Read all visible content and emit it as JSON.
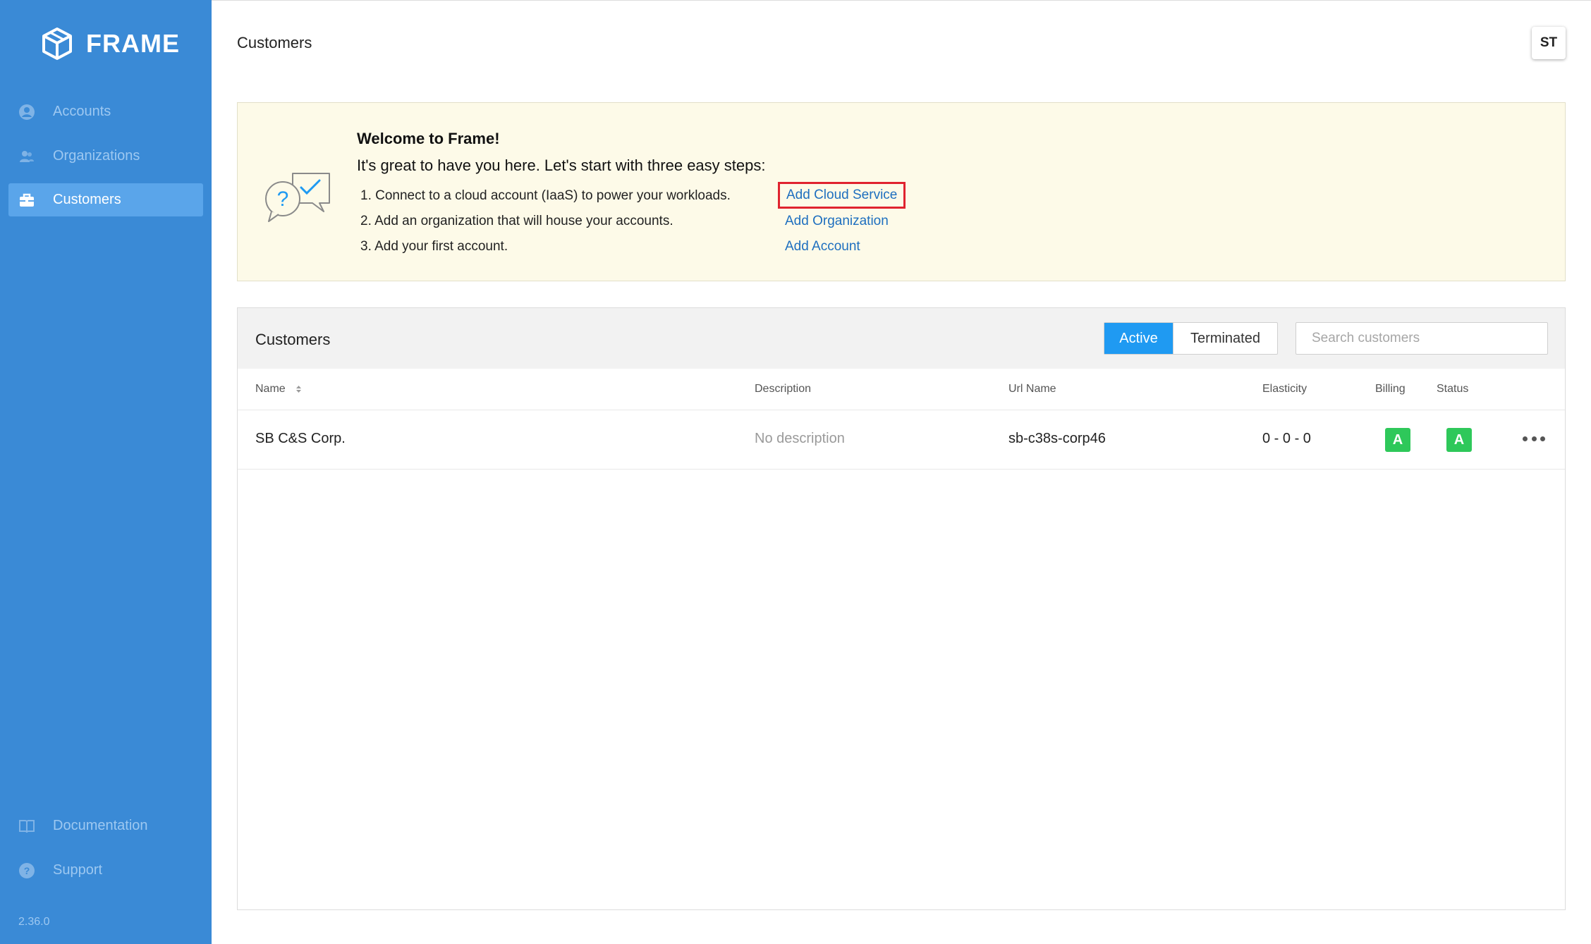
{
  "app": {
    "brand": "FRAME",
    "version": "2.36.0"
  },
  "sidebar": {
    "items": [
      {
        "label": "Accounts",
        "icon": "user-circle-icon",
        "active": false
      },
      {
        "label": "Organizations",
        "icon": "users-icon",
        "active": false
      },
      {
        "label": "Customers",
        "icon": "briefcase-icon",
        "active": true
      }
    ],
    "bottom_items": [
      {
        "label": "Documentation",
        "icon": "book-icon"
      },
      {
        "label": "Support",
        "icon": "help-circle-icon"
      }
    ]
  },
  "header": {
    "title": "Customers",
    "user_initials": "ST"
  },
  "welcome": {
    "heading": "Welcome to Frame!",
    "intro": "It's great to have you here. Let's start with three easy steps:",
    "steps": [
      {
        "text": "1. Connect to a cloud account (IaaS) to power your workloads.",
        "link": "Add Cloud Service"
      },
      {
        "text": "2. Add an organization that will house your accounts.",
        "link": "Add Organization"
      },
      {
        "text": "3. Add your first account.",
        "link": "Add Account"
      }
    ],
    "highlight_color": "#e0232f"
  },
  "customers": {
    "title": "Customers",
    "filters": {
      "active": "Active",
      "terminated": "Terminated",
      "selected": "Active"
    },
    "search_placeholder": "Search customers",
    "columns": [
      "Name",
      "Description",
      "Url Name",
      "Elasticity",
      "Billing",
      "Status"
    ],
    "rows": [
      {
        "name": "SB C&S Corp.",
        "description": "No description",
        "url_name": "sb-c38s-corp46",
        "elasticity": "0 - 0 - 0",
        "billing": "A",
        "status": "A"
      }
    ]
  },
  "colors": {
    "sidebar": "#3a8ad6",
    "accent": "#1f9af2",
    "badge": "#2ec85a",
    "link": "#1e6fbf"
  }
}
